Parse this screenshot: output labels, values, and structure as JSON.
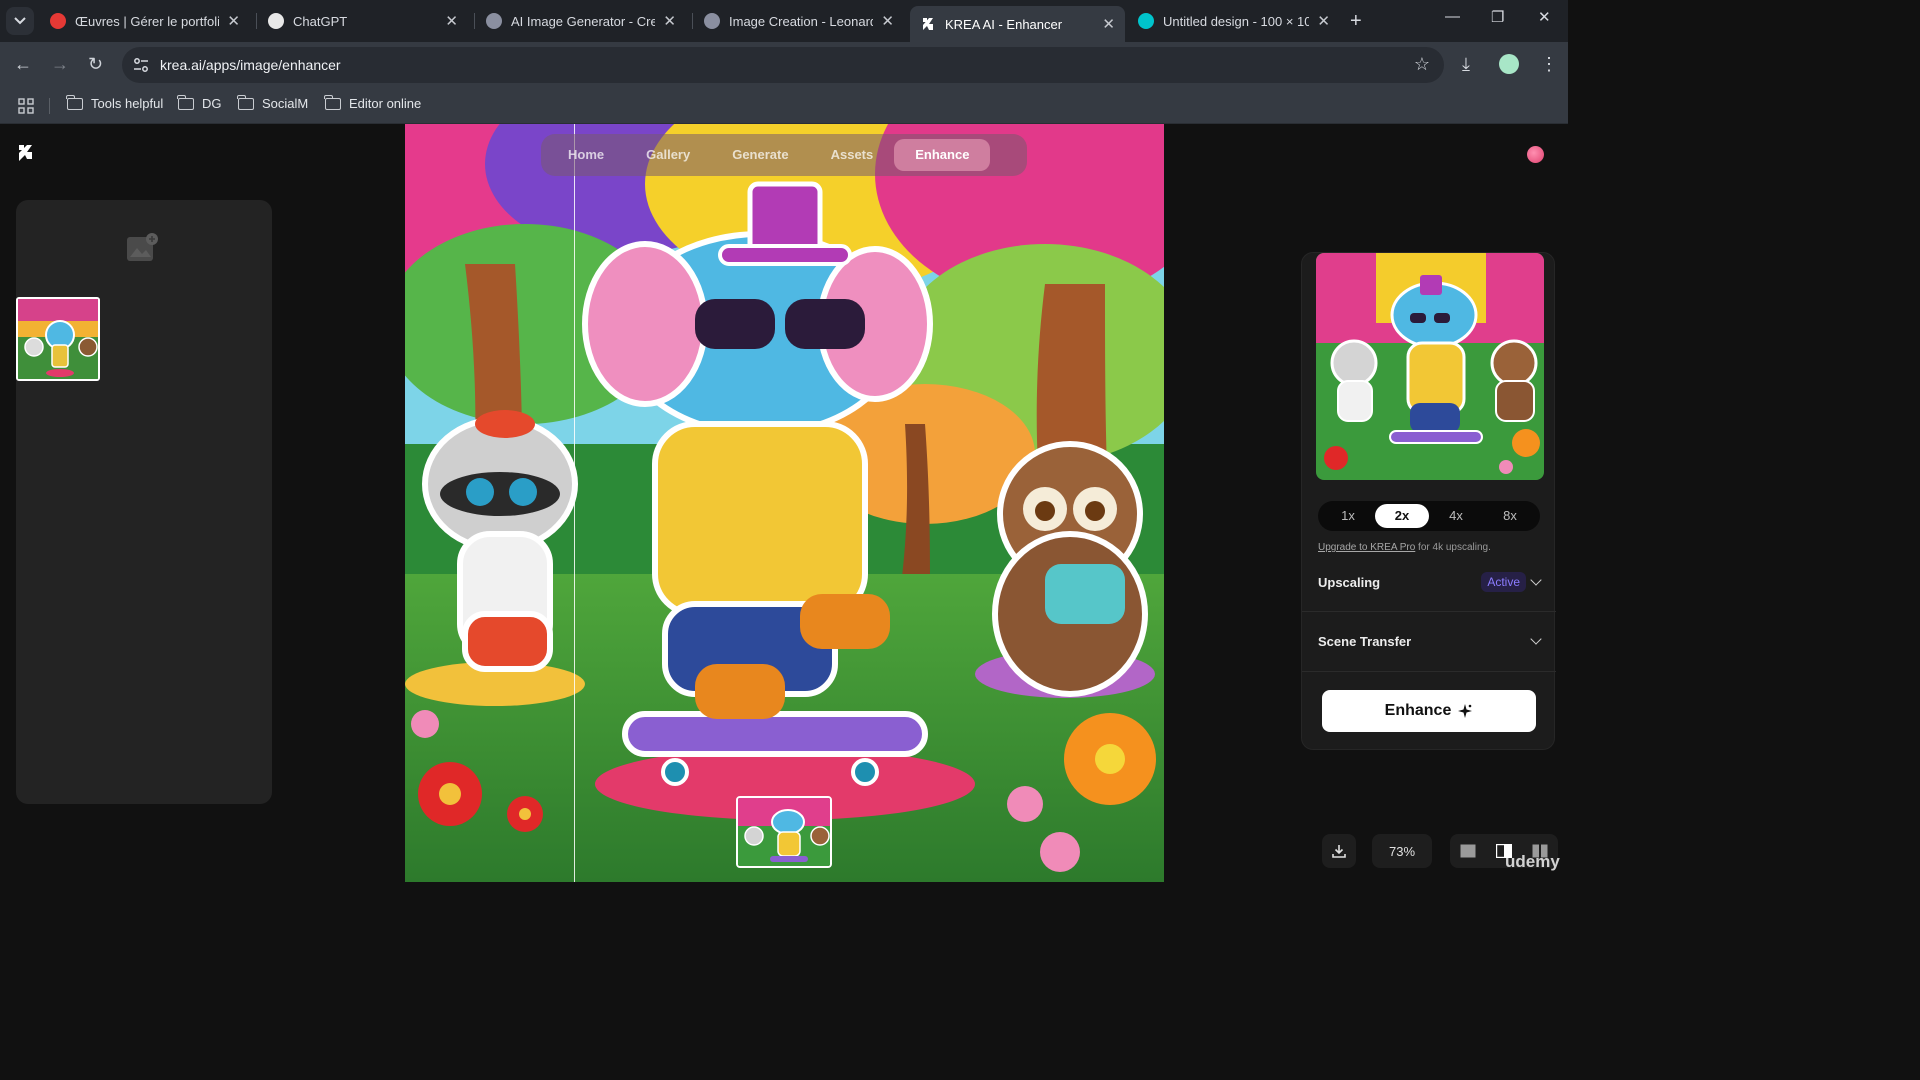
{
  "browser": {
    "tabs": [
      {
        "title": "Œuvres | Gérer le portfolio",
        "favicon_color": "#e53935"
      },
      {
        "title": "ChatGPT",
        "favicon_color": "#e8e8e8"
      },
      {
        "title": "AI Image Generator - Crea",
        "favicon_color": "#8a8fa0"
      },
      {
        "title": "Image Creation - Leonardo",
        "favicon_color": "#8a8fa0"
      },
      {
        "title": "KREA AI - Enhancer",
        "favicon_color": "#ffffff"
      },
      {
        "title": "Untitled design - 100 × 10",
        "favicon_color": "#00c4cc"
      }
    ],
    "active_tab_index": 4,
    "url": "krea.ai/apps/image/enhancer",
    "bookmarks": [
      "Tools helpful",
      "DG",
      "SocialM",
      "Editor online"
    ]
  },
  "app": {
    "nav": [
      "Home",
      "Gallery",
      "Generate",
      "Assets",
      "Enhance"
    ],
    "active_nav": "Enhance",
    "scale_options": [
      "1x",
      "2x",
      "4x",
      "8x"
    ],
    "active_scale": "2x",
    "upgrade_link": "Upgrade to KREA Pro",
    "upgrade_rest": " for 4k upscaling.",
    "sections": {
      "upscaling_label": "Upscaling",
      "upscaling_status": "Active",
      "scene_transfer_label": "Scene Transfer"
    },
    "enhance_label": "Enhance",
    "zoom": "73%",
    "watermark": "udemy"
  }
}
